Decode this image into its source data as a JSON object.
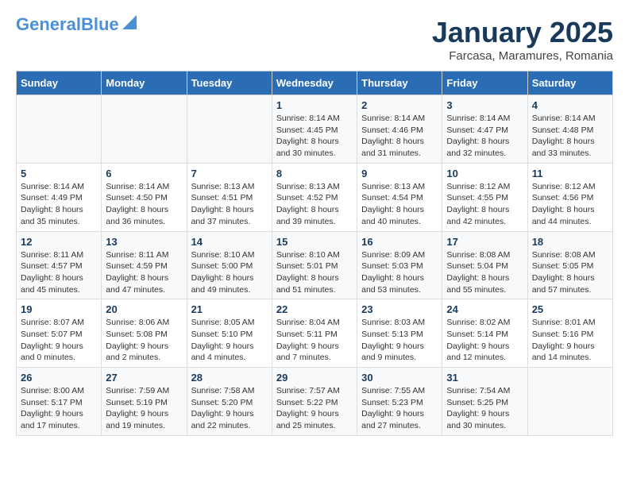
{
  "header": {
    "logo_line1": "General",
    "logo_line2": "Blue",
    "month": "January 2025",
    "location": "Farcasa, Maramures, Romania"
  },
  "days_of_week": [
    "Sunday",
    "Monday",
    "Tuesday",
    "Wednesday",
    "Thursday",
    "Friday",
    "Saturday"
  ],
  "weeks": [
    [
      {
        "day": "",
        "text": ""
      },
      {
        "day": "",
        "text": ""
      },
      {
        "day": "",
        "text": ""
      },
      {
        "day": "1",
        "text": "Sunrise: 8:14 AM\nSunset: 4:45 PM\nDaylight: 8 hours\nand 30 minutes."
      },
      {
        "day": "2",
        "text": "Sunrise: 8:14 AM\nSunset: 4:46 PM\nDaylight: 8 hours\nand 31 minutes."
      },
      {
        "day": "3",
        "text": "Sunrise: 8:14 AM\nSunset: 4:47 PM\nDaylight: 8 hours\nand 32 minutes."
      },
      {
        "day": "4",
        "text": "Sunrise: 8:14 AM\nSunset: 4:48 PM\nDaylight: 8 hours\nand 33 minutes."
      }
    ],
    [
      {
        "day": "5",
        "text": "Sunrise: 8:14 AM\nSunset: 4:49 PM\nDaylight: 8 hours\nand 35 minutes."
      },
      {
        "day": "6",
        "text": "Sunrise: 8:14 AM\nSunset: 4:50 PM\nDaylight: 8 hours\nand 36 minutes."
      },
      {
        "day": "7",
        "text": "Sunrise: 8:13 AM\nSunset: 4:51 PM\nDaylight: 8 hours\nand 37 minutes."
      },
      {
        "day": "8",
        "text": "Sunrise: 8:13 AM\nSunset: 4:52 PM\nDaylight: 8 hours\nand 39 minutes."
      },
      {
        "day": "9",
        "text": "Sunrise: 8:13 AM\nSunset: 4:54 PM\nDaylight: 8 hours\nand 40 minutes."
      },
      {
        "day": "10",
        "text": "Sunrise: 8:12 AM\nSunset: 4:55 PM\nDaylight: 8 hours\nand 42 minutes."
      },
      {
        "day": "11",
        "text": "Sunrise: 8:12 AM\nSunset: 4:56 PM\nDaylight: 8 hours\nand 44 minutes."
      }
    ],
    [
      {
        "day": "12",
        "text": "Sunrise: 8:11 AM\nSunset: 4:57 PM\nDaylight: 8 hours\nand 45 minutes."
      },
      {
        "day": "13",
        "text": "Sunrise: 8:11 AM\nSunset: 4:59 PM\nDaylight: 8 hours\nand 47 minutes."
      },
      {
        "day": "14",
        "text": "Sunrise: 8:10 AM\nSunset: 5:00 PM\nDaylight: 8 hours\nand 49 minutes."
      },
      {
        "day": "15",
        "text": "Sunrise: 8:10 AM\nSunset: 5:01 PM\nDaylight: 8 hours\nand 51 minutes."
      },
      {
        "day": "16",
        "text": "Sunrise: 8:09 AM\nSunset: 5:03 PM\nDaylight: 8 hours\nand 53 minutes."
      },
      {
        "day": "17",
        "text": "Sunrise: 8:08 AM\nSunset: 5:04 PM\nDaylight: 8 hours\nand 55 minutes."
      },
      {
        "day": "18",
        "text": "Sunrise: 8:08 AM\nSunset: 5:05 PM\nDaylight: 8 hours\nand 57 minutes."
      }
    ],
    [
      {
        "day": "19",
        "text": "Sunrise: 8:07 AM\nSunset: 5:07 PM\nDaylight: 9 hours\nand 0 minutes."
      },
      {
        "day": "20",
        "text": "Sunrise: 8:06 AM\nSunset: 5:08 PM\nDaylight: 9 hours\nand 2 minutes."
      },
      {
        "day": "21",
        "text": "Sunrise: 8:05 AM\nSunset: 5:10 PM\nDaylight: 9 hours\nand 4 minutes."
      },
      {
        "day": "22",
        "text": "Sunrise: 8:04 AM\nSunset: 5:11 PM\nDaylight: 9 hours\nand 7 minutes."
      },
      {
        "day": "23",
        "text": "Sunrise: 8:03 AM\nSunset: 5:13 PM\nDaylight: 9 hours\nand 9 minutes."
      },
      {
        "day": "24",
        "text": "Sunrise: 8:02 AM\nSunset: 5:14 PM\nDaylight: 9 hours\nand 12 minutes."
      },
      {
        "day": "25",
        "text": "Sunrise: 8:01 AM\nSunset: 5:16 PM\nDaylight: 9 hours\nand 14 minutes."
      }
    ],
    [
      {
        "day": "26",
        "text": "Sunrise: 8:00 AM\nSunset: 5:17 PM\nDaylight: 9 hours\nand 17 minutes."
      },
      {
        "day": "27",
        "text": "Sunrise: 7:59 AM\nSunset: 5:19 PM\nDaylight: 9 hours\nand 19 minutes."
      },
      {
        "day": "28",
        "text": "Sunrise: 7:58 AM\nSunset: 5:20 PM\nDaylight: 9 hours\nand 22 minutes."
      },
      {
        "day": "29",
        "text": "Sunrise: 7:57 AM\nSunset: 5:22 PM\nDaylight: 9 hours\nand 25 minutes."
      },
      {
        "day": "30",
        "text": "Sunrise: 7:55 AM\nSunset: 5:23 PM\nDaylight: 9 hours\nand 27 minutes."
      },
      {
        "day": "31",
        "text": "Sunrise: 7:54 AM\nSunset: 5:25 PM\nDaylight: 9 hours\nand 30 minutes."
      },
      {
        "day": "",
        "text": ""
      }
    ]
  ]
}
